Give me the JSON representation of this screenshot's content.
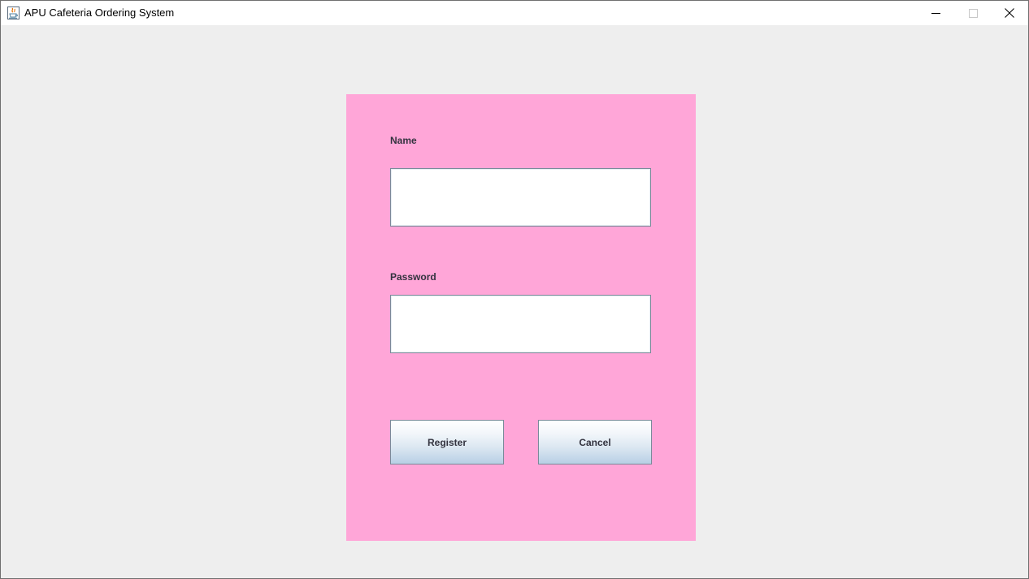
{
  "window": {
    "title": "APU Cafeteria Ordering System",
    "icon": "java-cup-icon"
  },
  "form": {
    "name_label": "Name",
    "name_value": "",
    "password_label": "Password",
    "password_value": "",
    "register_label": "Register",
    "cancel_label": "Cancel"
  },
  "colors": {
    "panel": "#ffa6d8",
    "background": "#eeeeee",
    "label_text": "#33333f"
  }
}
